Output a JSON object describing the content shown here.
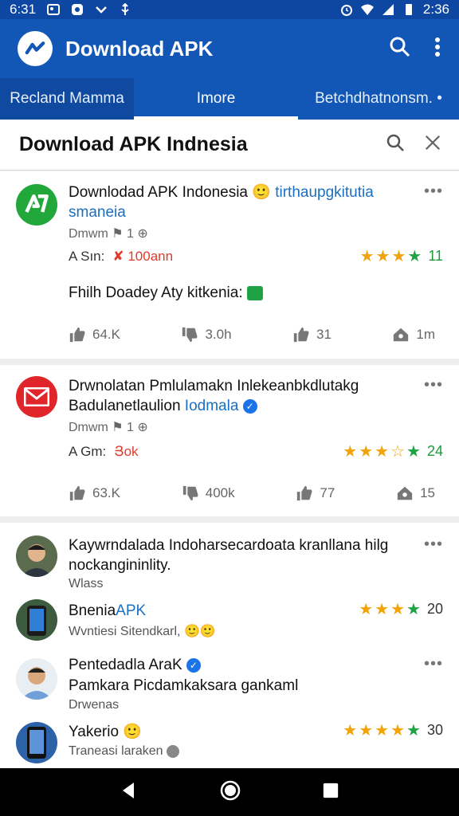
{
  "status_bar": {
    "time_left": "6:31",
    "time_right": "2:36"
  },
  "app_bar": {
    "title": "Download APK",
    "colors": {
      "primary": "#1257b5",
      "status": "#0d47a1"
    }
  },
  "tabs": [
    {
      "label": "Recland Mamma"
    },
    {
      "label": "Imore"
    },
    {
      "label": "Betchdhatnonsm. •"
    }
  ],
  "search_header": {
    "title": "Download APK Indnesia"
  },
  "cards": [
    {
      "icon": "apk-logo-icon",
      "title_a": "Downlodad APK Indonesia",
      "title_b": "tirthaupgkitutia smaneia",
      "meta": "Dmwm ⚑ 1 ⊕",
      "label": "A Sın:",
      "badge": "✘ 100ann",
      "rating": "11",
      "desc": "Fhilh Doadey Aty kitkenia:",
      "actions": [
        "64.K",
        "3.0h",
        "31",
        "1m"
      ]
    },
    {
      "icon": "mail-icon",
      "title_a": "Drwnolatan Pmlulamakn Inlekeanbkdlutakg",
      "title_b": "Badulanetlaulion",
      "title_c": "Iodmala",
      "meta": "Dmwm ⚑ 1 ⊕",
      "label": "A Gm:",
      "badge": "Յok",
      "rating": "24",
      "actions": [
        "63.K",
        "400k",
        "77",
        "15"
      ]
    }
  ],
  "list": [
    {
      "title": "Kaywrndalada Indoharsecardoata kranllana hilg nockangininlity.",
      "sub": "Wlass"
    },
    {
      "title": "Bnenia APK",
      "title_plain": "Bnenia",
      "title_hl": "APK",
      "sub": "Wvntiesi Sitendkarl,",
      "rating": "20"
    },
    {
      "title": "Pentedadla AraK",
      "body": "Pamkara Picdamkaksara gankaml",
      "sub": "Drwenas"
    },
    {
      "title": "Yakerio",
      "sub": "Traneasi laraken",
      "rating": "30"
    }
  ]
}
